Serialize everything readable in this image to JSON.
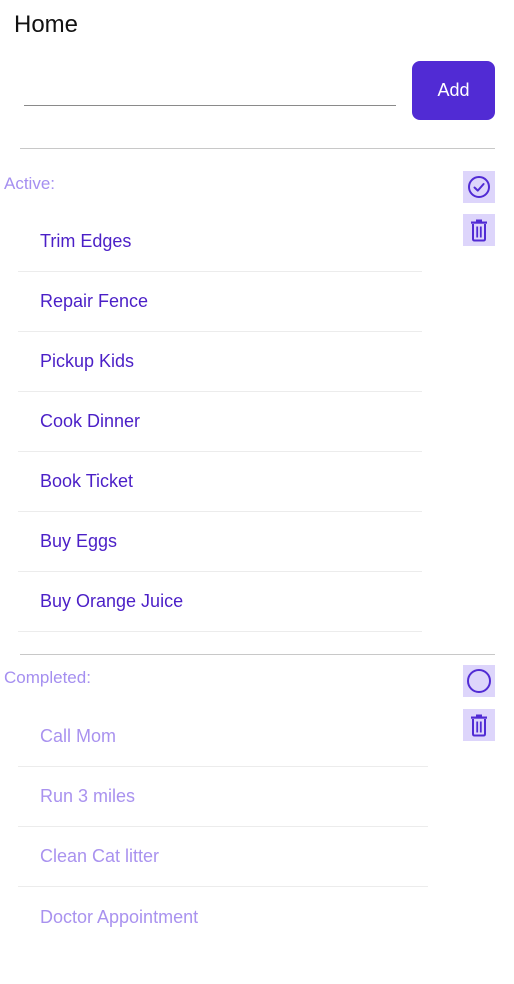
{
  "header": {
    "title": "Home"
  },
  "entry": {
    "value": "",
    "placeholder": "",
    "add_label": "Add"
  },
  "active": {
    "label": "Active:",
    "items": [
      "Trim Edges",
      "Repair Fence",
      "Pickup Kids",
      "Cook Dinner",
      "Book Ticket",
      "Buy Eggs",
      "Buy Orange Juice"
    ],
    "icons": [
      "check-circle-icon",
      "trash-icon"
    ]
  },
  "completed": {
    "label": "Completed:",
    "items": [
      "Call Mom",
      "Run 3 miles",
      "Clean Cat litter",
      "Doctor Appointment"
    ],
    "icons": [
      "circle-icon",
      "trash-icon"
    ]
  },
  "colors": {
    "accent": "#512bd4",
    "active_text": "#4b1fc7",
    "muted_text": "#a992ef",
    "icon_bg": "#ddd5fb"
  }
}
